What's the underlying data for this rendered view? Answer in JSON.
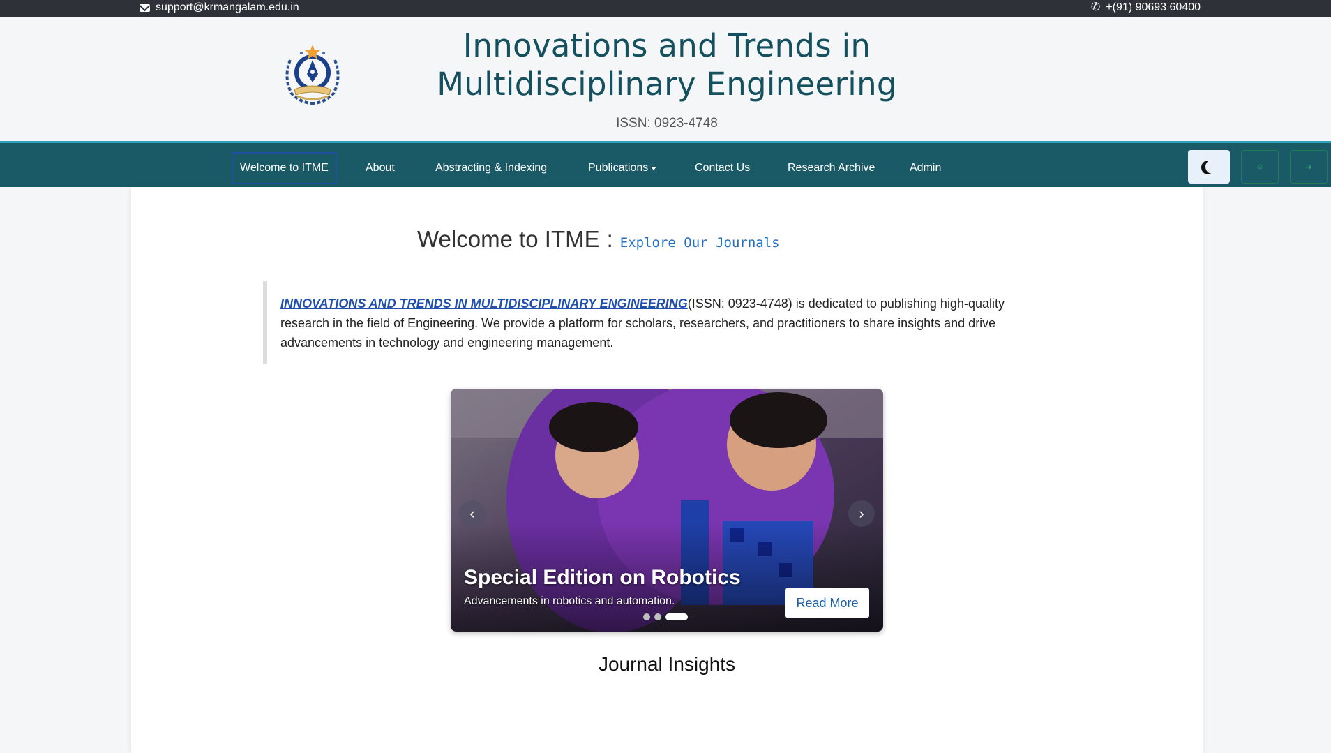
{
  "topbar": {
    "email": "support@krmangalam.edu.in",
    "phone": "+(91) 90693 60400",
    "email_icon": "envelope-icon",
    "phone_icon": "phone-icon"
  },
  "header": {
    "title": "Innovations and Trends in Multidisciplinary Engineering",
    "issn": "ISSN: 0923-4748",
    "logo_icon": "journal-logo-icon"
  },
  "nav": {
    "items": [
      {
        "label": "Welcome to ITME",
        "active": true
      },
      {
        "label": "About"
      },
      {
        "label": "Abstracting & Indexing"
      },
      {
        "label": "Publications",
        "dropdown": true
      },
      {
        "label": "Contact Us"
      },
      {
        "label": "Research Archive"
      },
      {
        "label": "Admin"
      }
    ],
    "theme_icon": "moon-icon",
    "user_icon": "user-icon",
    "login_icon": "sign-in-icon"
  },
  "main": {
    "welcome_title": "Welcome to ITME",
    "welcome_colon": ":",
    "explore_text": "Explore Our Journals",
    "intro_link": "INNOVATIONS AND TRENDS IN MULTIDISCIPLINARY ENGINEERING",
    "intro_text": "(ISSN: 0923-4748) is dedicated to publishing high-quality research in the field of Engineering. We provide a platform for scholars, researchers, and practitioners to share insights and drive advancements in technology and engineering management.",
    "carousel": {
      "title": "Special Edition on Robotics",
      "subtitle": "Advancements in robotics and automation.",
      "button": "Read More",
      "prev": "‹",
      "next": "›",
      "slides": 3,
      "active_slide": 3
    },
    "insights_title": "Journal Insights"
  },
  "colors": {
    "topbar": "#2e3238",
    "nav": "#1a5a66",
    "title": "#14505e",
    "link": "#1f4fb0"
  }
}
